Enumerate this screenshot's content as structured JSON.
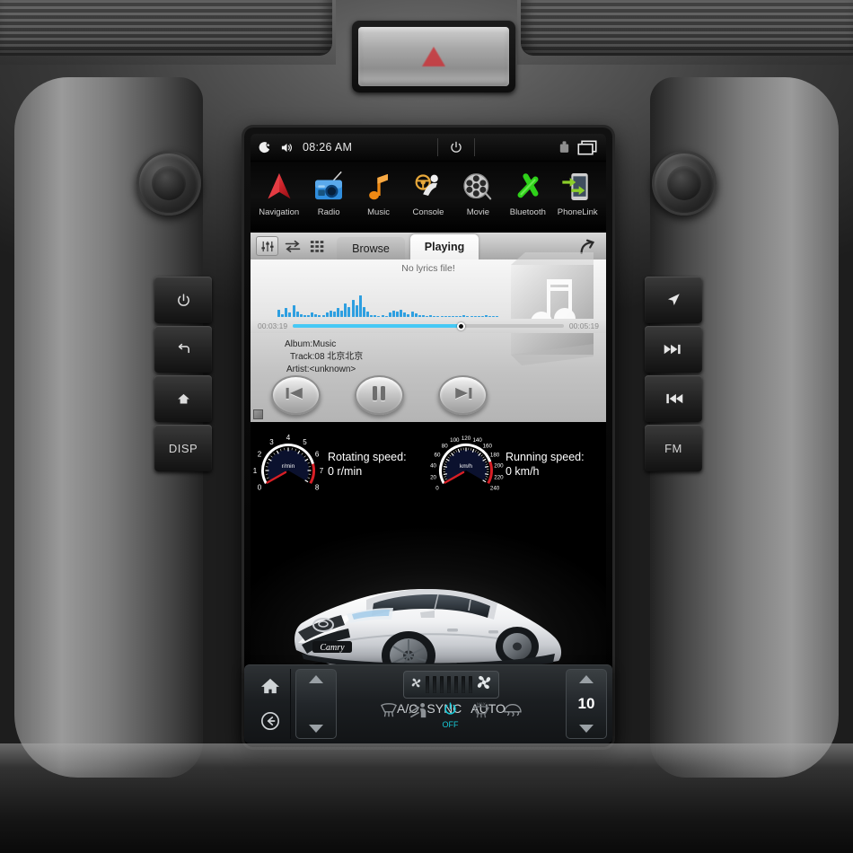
{
  "dashboard": {
    "hazard_button": "hazard-warning-button"
  },
  "hardware_buttons": {
    "left": [
      {
        "name": "power",
        "icon": "power-icon",
        "label": ""
      },
      {
        "name": "back",
        "icon": "back-arrow-icon",
        "label": ""
      },
      {
        "name": "home",
        "icon": "home-icon",
        "label": ""
      },
      {
        "name": "disp",
        "icon": "",
        "label": "DISP"
      }
    ],
    "right": [
      {
        "name": "navigation",
        "icon": "navigation-arrow-icon",
        "label": ""
      },
      {
        "name": "next-track",
        "icon": "next-track-icon",
        "label": ""
      },
      {
        "name": "previous-track",
        "icon": "previous-track-icon",
        "label": ""
      },
      {
        "name": "fm-radio",
        "icon": "",
        "label": "FM"
      }
    ]
  },
  "status_bar": {
    "night_mode_icon": "moon-star-icon",
    "volume_icon": "speaker-icon",
    "time": "08:26 AM",
    "power_icon": "power-icon",
    "storage_icon": "usb-drive-icon",
    "windows_icon": "recent-apps-icon"
  },
  "apps": [
    {
      "label": "Navigation",
      "icon": "navigation-arrow-icon"
    },
    {
      "label": "Radio",
      "icon": "radio-icon"
    },
    {
      "label": "Music",
      "icon": "music-note-icon"
    },
    {
      "label": "Console",
      "icon": "steering-wheel-icon"
    },
    {
      "label": "Movie",
      "icon": "film-reel-icon"
    },
    {
      "label": "Bluetooth",
      "icon": "bluetooth-icon"
    },
    {
      "label": "PhoneLink",
      "icon": "phone-link-icon"
    }
  ],
  "player": {
    "toolbar": {
      "equalizer_icon": "equalizer-icon",
      "repeat_icon": "repeat-shuffle-icon",
      "list_icon": "playlist-grid-icon",
      "back_icon": "return-arrow-icon"
    },
    "tabs": [
      {
        "label": "Browse",
        "active": false
      },
      {
        "label": "Playing",
        "active": true
      }
    ],
    "lyrics_message": "No lyrics file!",
    "elapsed_time": "00:03:19",
    "total_time": "00:05:19",
    "progress_percent": 62,
    "waveform": [
      14,
      6,
      18,
      9,
      22,
      11,
      5,
      4,
      3,
      8,
      5,
      4,
      3,
      9,
      13,
      10,
      17,
      12,
      26,
      19,
      34,
      23,
      42,
      20,
      11,
      4,
      3,
      2,
      3,
      2,
      8,
      13,
      10,
      14,
      9,
      6,
      11,
      7,
      4,
      3,
      2,
      3,
      2,
      2,
      2,
      2,
      2,
      2,
      2,
      2,
      3,
      2,
      2,
      2,
      2,
      2,
      3,
      2,
      2,
      2
    ],
    "album": "Album:Music",
    "track": "Track:08 北京北京",
    "artist": "Artist:<unknown>",
    "album_art_icon": "music-note-album-art",
    "controls": {
      "previous": "previous-track-icon",
      "pause": "pause-icon",
      "next": "next-track-icon"
    }
  },
  "gauges": {
    "tachometer": {
      "unit_label": "r/min",
      "ticks": [
        "0",
        "1",
        "2",
        "3",
        "4",
        "5",
        "6",
        "7",
        "8"
      ],
      "readout_title": "Rotating speed:",
      "readout_value": "0 r/min",
      "value": 0,
      "min": 0,
      "max": 8,
      "redline_start": 6.5
    },
    "speedometer": {
      "unit_label": "km/h",
      "ticks": [
        "0",
        "20",
        "40",
        "60",
        "80",
        "100",
        "120",
        "140",
        "160",
        "180",
        "200",
        "220",
        "240"
      ],
      "readout_title": "Running speed:",
      "readout_value": "0 km/h",
      "value": 0,
      "min": 0,
      "max": 240,
      "redline_start": 190
    }
  },
  "car_image": {
    "model_badge": "Camry",
    "description": "white-sedan-front-three-quarter"
  },
  "climate": {
    "home_icon": "home-icon",
    "back_icon": "back-circle-icon",
    "left_stepper": {
      "name": "driver-temperature",
      "value": ""
    },
    "right_stepper": {
      "name": "passenger-temperature",
      "value": "10"
    },
    "fan": {
      "low_icon": "fan-small-icon",
      "high_icon": "fan-large-icon",
      "segments": 7,
      "level": 0
    },
    "labels": [
      "A/C",
      "SYNC",
      "AUTO"
    ],
    "rear_defrost_icon": "rear-defrost-icon",
    "airflow_icon": "airflow-body-icon",
    "power_label": "OFF",
    "power_icon": "power-icon",
    "max_defrost_icon": "max-defrost-icon",
    "windshield_defrost_icon": "windshield-defrost-icon"
  },
  "colors": {
    "accent_cyan": "#17c8d6",
    "progress_blue": "#46c8f5",
    "waveform_blue": "#2e9fe0",
    "gauge_red": "#d81f26",
    "navigation_red": "#cc2229",
    "radio_blue": "#1a72c8",
    "music_orange": "#f08a14",
    "bluetooth_green": "#2fd11a"
  }
}
